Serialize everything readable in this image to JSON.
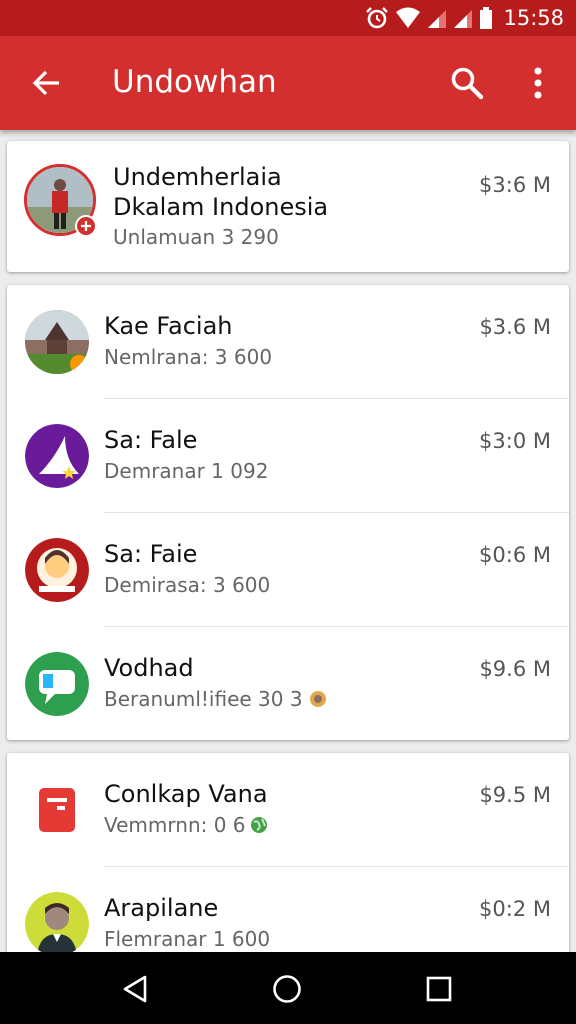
{
  "status_bar": {
    "time": "15:58",
    "icons": [
      "alarm-icon",
      "wifi-icon",
      "signal-icon",
      "signal-icon",
      "battery-icon"
    ]
  },
  "app_bar": {
    "title": "Undowhan",
    "icons": [
      "back-arrow-icon",
      "search-icon",
      "more-vert-icon"
    ]
  },
  "header_item": {
    "title_line1": "Undemherlaia",
    "title_line2": "Dkalam Indonesia",
    "subtitle": "Unlamuan 3 290",
    "price": "$3:6 M"
  },
  "list_group_1": [
    {
      "title": "Kae Faciah",
      "subtitle": "Nemlrana: 3 600",
      "price": "$3.6 M"
    },
    {
      "title": "Sa: Fale",
      "subtitle": "Demranar 1 092",
      "price": "$3:0 M"
    },
    {
      "title": "Sa: Faie",
      "subtitle": "Demirasa: 3 600",
      "price": "$0:6 M"
    },
    {
      "title": "Vodhad",
      "subtitle": "Beranuml!ifiee 30 3",
      "price": "$9.6 M"
    }
  ],
  "list_group_2": [
    {
      "title": "Conlkap Vana",
      "subtitle": "Vemmrnn: 0 6",
      "price": "$9.5 M"
    },
    {
      "title": "Arapilane",
      "subtitle": "Flemranar 1 600",
      "price": "$0:2 M"
    }
  ],
  "nav_bar": {
    "icons": [
      "nav-back-icon",
      "nav-home-icon",
      "nav-recents-icon"
    ]
  },
  "colors": {
    "status_bar": "#b71c1c",
    "app_bar": "#d32f2f",
    "background": "#ececec",
    "nav_bar": "#000000"
  }
}
